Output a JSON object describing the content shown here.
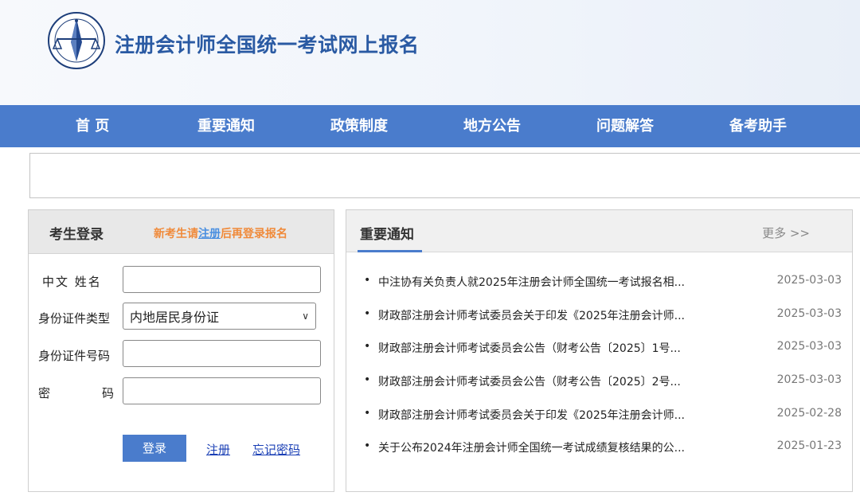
{
  "header": {
    "site_title": "注册会计师全国统一考试网上报名",
    "logo_icon": "cicpa-emblem-icon"
  },
  "nav": {
    "items": [
      "首 页",
      "重要通知",
      "政策制度",
      "地方公告",
      "问题解答",
      "备考助手"
    ]
  },
  "login": {
    "title": "考生登录",
    "hint_prefix": "新考生请",
    "hint_link": "注册",
    "hint_suffix": "后再登录报名",
    "labels": {
      "name": "中文 姓名",
      "id_type": "身份证件类型",
      "id_number": "身份证件号码",
      "password_a": "密",
      "password_b": "码"
    },
    "id_type_value": "内地居民身份证",
    "login_button": "登录",
    "register_link": "注册",
    "forgot_link": "忘记密码"
  },
  "notices": {
    "title": "重要通知",
    "more": "更多 >>",
    "items": [
      {
        "title": "中注协有关负责人就2025年注册会计师全国统一考试报名相...",
        "date": "2025-03-03"
      },
      {
        "title": "财政部注册会计师考试委员会关于印发《2025年注册会计师...",
        "date": "2025-03-03"
      },
      {
        "title": "财政部注册会计师考试委员会公告（财考公告〔2025〕1号...",
        "date": "2025-03-03"
      },
      {
        "title": "财政部注册会计师考试委员会公告（财考公告〔2025〕2号...",
        "date": "2025-03-03"
      },
      {
        "title": "财政部注册会计师考试委员会关于印发《2025年注册会计师...",
        "date": "2025-02-28"
      },
      {
        "title": "关于公布2024年注册会计师全国统一考试成绩复核结果的公...",
        "date": "2025-01-23"
      }
    ]
  },
  "colors": {
    "nav_bg": "#4a7ccc",
    "title_blue": "#2a5aa3",
    "hint_orange": "#f08a3a"
  }
}
